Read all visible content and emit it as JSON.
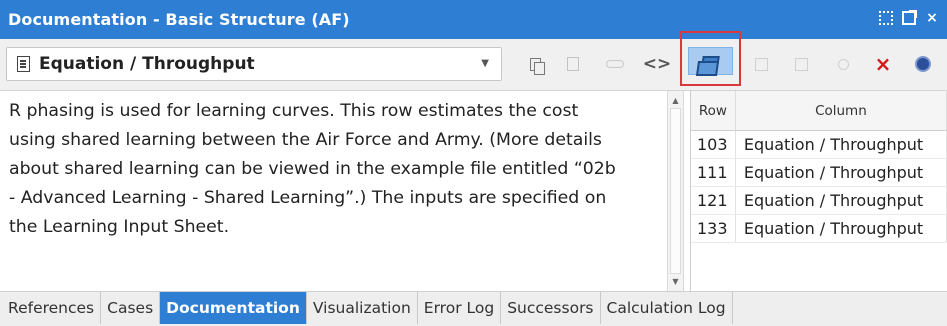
{
  "window": {
    "title": "Documentation  - Basic Structure (AF)",
    "icons": [
      "expand-icon",
      "popout-icon",
      "close-icon"
    ]
  },
  "toolbar": {
    "selected_item": "Equation / Throughput",
    "buttons": [
      "copy-icon",
      "paste-icon",
      "link-icon",
      "code-icon",
      "windows-icon",
      "page-icon",
      "save-icon",
      "star-icon",
      "delete-icon",
      "help-icon"
    ],
    "highlighted_button": "windows-icon",
    "highlight_color": "#d9393a"
  },
  "documentation": {
    "lines": [
      "R phasing is used for learning curves. This row estimates the cost",
      "using shared learning between the Air Force and Army.  (More details",
      "about shared learning can be viewed in the example file entitled “02b",
      "- Advanced Learning - Shared Learning”.)  The inputs are specified on",
      "the Learning Input Sheet."
    ]
  },
  "references": {
    "headers": [
      "Row",
      "Column"
    ],
    "rows": [
      {
        "row": "103",
        "column": "Equation / Throughput"
      },
      {
        "row": "111",
        "column": "Equation / Throughput"
      },
      {
        "row": "121",
        "column": "Equation / Throughput"
      },
      {
        "row": "133",
        "column": "Equation / Throughput"
      }
    ]
  },
  "tabs": [
    {
      "label": "References",
      "active": false
    },
    {
      "label": "Cases",
      "active": false
    },
    {
      "label": "Documentation",
      "active": true
    },
    {
      "label": "Visualization",
      "active": false
    },
    {
      "label": "Error Log",
      "active": false
    },
    {
      "label": "Successors",
      "active": false
    },
    {
      "label": "Calculation Log",
      "active": false
    }
  ],
  "colors": {
    "accent": "#2e7ed4",
    "delete": "#d41b1b"
  }
}
